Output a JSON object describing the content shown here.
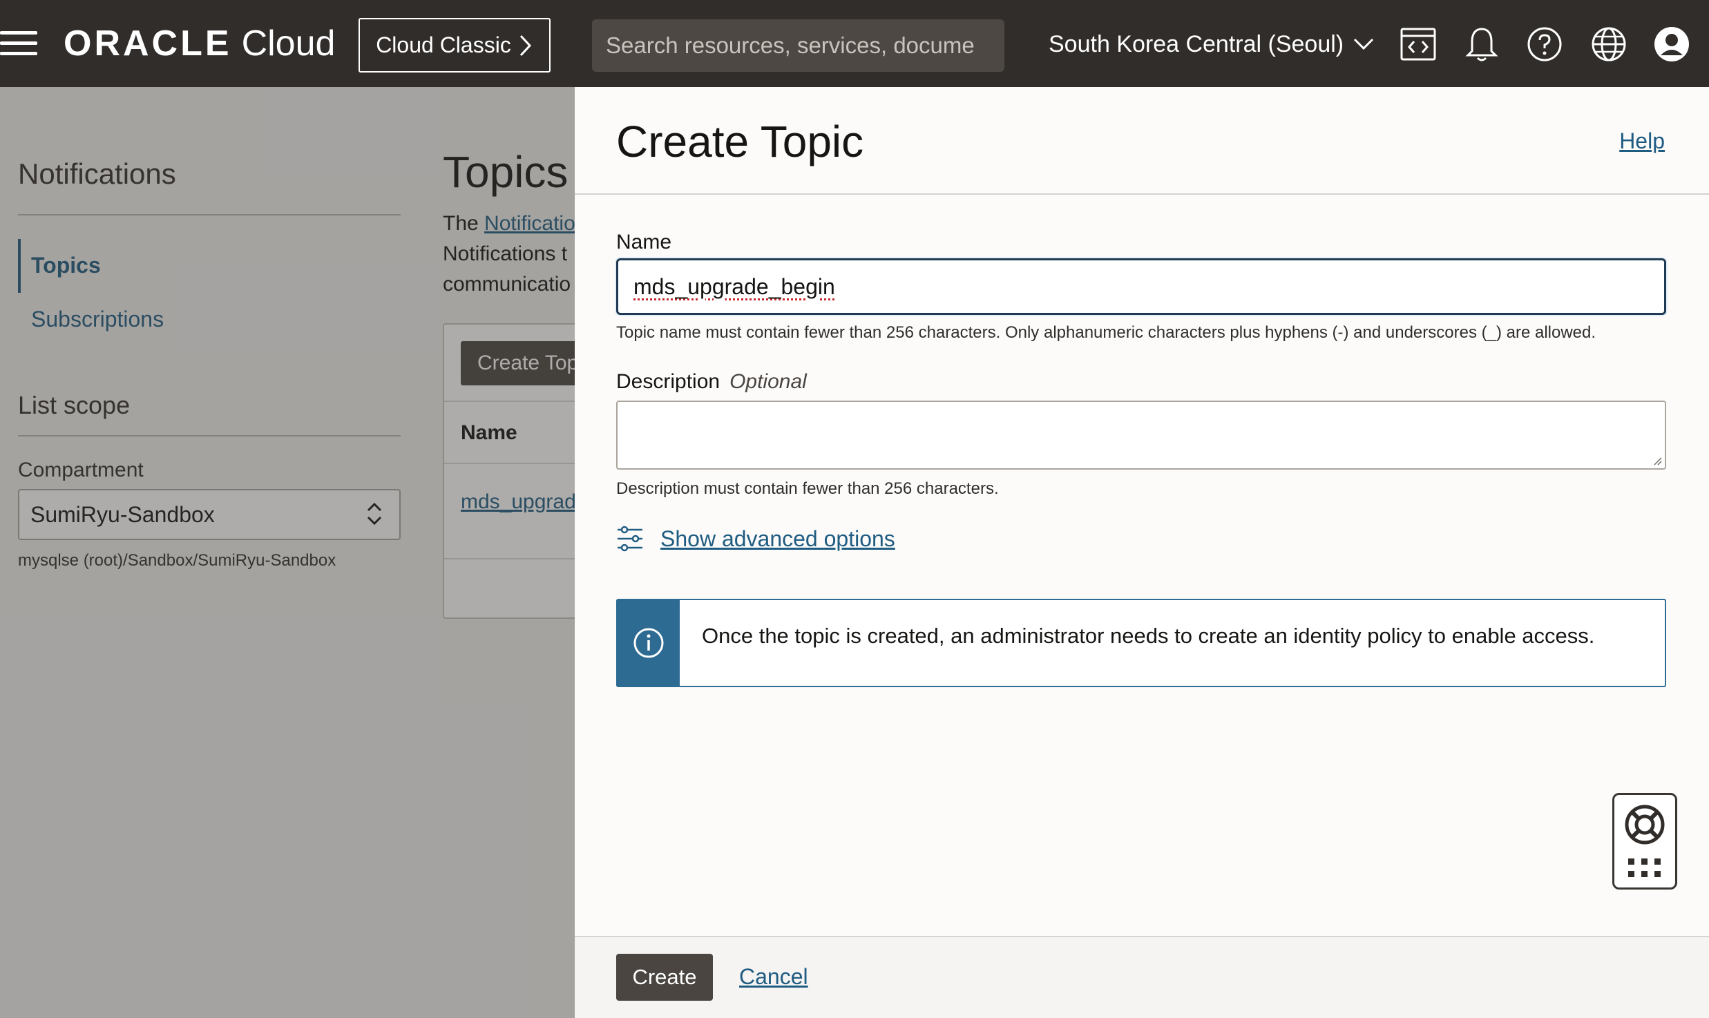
{
  "header": {
    "logo_brand": "ORACLE",
    "logo_product": "Cloud",
    "classic_button": "Cloud Classic",
    "search_placeholder": "Search resources, services, docume",
    "region": "South Korea Central (Seoul)"
  },
  "background": {
    "sidebar_title": "Notifications",
    "nav": [
      "Topics",
      "Subscriptions"
    ],
    "scope_title": "List scope",
    "compartment_label": "Compartment",
    "compartment_value": "SumiRyu-Sandbox",
    "compartment_path": "mysqlse (root)/Sandbox/SumiRyu-Sandbox",
    "page_title": "Topics",
    "desc_prefix": "The ",
    "desc_link": "Notificatio",
    "desc_line2": "Notifications t",
    "desc_line3": "communicatio",
    "create_topic_button": "Create Top",
    "table_header_name": "Name",
    "table_row_name": "mds_upgrad"
  },
  "panel": {
    "title": "Create Topic",
    "help": "Help",
    "name_label": "Name",
    "name_value": "mds_upgrade_begin",
    "name_hint": "Topic name must contain fewer than 256 characters. Only alphanumeric characters plus hyphens (-) and underscores (_) are allowed.",
    "description_label": "Description",
    "description_optional": "Optional",
    "description_value": "",
    "description_hint": "Description must contain fewer than 256 characters.",
    "advanced_options": "Show advanced options",
    "info_message": "Once the topic is created, an administrator needs to create an identity policy to enable access.",
    "create_button": "Create",
    "cancel_link": "Cancel"
  },
  "colors": {
    "header_bg": "#312d2a",
    "link": "#1f5c82",
    "info_accent": "#2d6b93",
    "primary_button": "#4a4541"
  }
}
